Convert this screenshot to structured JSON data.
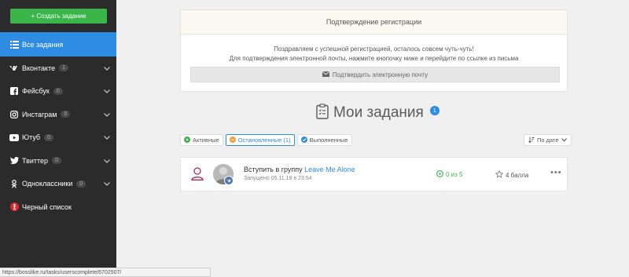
{
  "sidebar": {
    "create_label": "+ Создать задание",
    "items": [
      {
        "label": "Все задания",
        "icon": "list-icon",
        "badge": "",
        "active": true,
        "chevron": false
      },
      {
        "label": "Вконтакте",
        "icon": "vk-icon",
        "badge": "1",
        "active": false,
        "chevron": true
      },
      {
        "label": "Фейсбук",
        "icon": "facebook-icon",
        "badge": "0",
        "active": false,
        "chevron": true
      },
      {
        "label": "Инстаграм",
        "icon": "instagram-icon",
        "badge": "0",
        "active": false,
        "chevron": true
      },
      {
        "label": "Ютуб",
        "icon": "youtube-icon",
        "badge": "0",
        "active": false,
        "chevron": true
      },
      {
        "label": "Твиттер",
        "icon": "twitter-icon",
        "badge": "0",
        "active": false,
        "chevron": true
      },
      {
        "label": "Одноклассники",
        "icon": "odnoklassniki-icon",
        "badge": "0",
        "active": false,
        "chevron": true
      },
      {
        "label": "Черный список",
        "icon": "blacklist-icon",
        "badge": "",
        "active": false,
        "chevron": false
      }
    ]
  },
  "confirm": {
    "header": "Подтверждение регистрации",
    "line1": "Поздравляем с успешной регистрацией, осталось совсем чуть-чуть!",
    "line2": "Для подтверждения электронной почты, нажмите кнопочку ниже и перейдите по ссылке из письма",
    "button_label": "Подтвердить электронную почту"
  },
  "page": {
    "title": "Мои задания",
    "title_badge": "1"
  },
  "filters": {
    "active": "Активные",
    "stopped": "Остановленные (1)",
    "completed": "Выполненные",
    "sort": "По дате"
  },
  "task": {
    "action": "Вступить в группу ",
    "target": "Leave Me Alone",
    "started": "Запущено 05.11.18 в 23:54",
    "progress": "0 из 5",
    "points": "4 балла",
    "more": "•••"
  },
  "status_url": "https://bosslike.ru/tasks/userscomplete/6702507/",
  "colors": {
    "sidebar_bg": "#2b2b2b",
    "accent_blue": "#2f8ce3",
    "create_green": "#3ab54a",
    "stopped_orange": "#f39c3c"
  }
}
